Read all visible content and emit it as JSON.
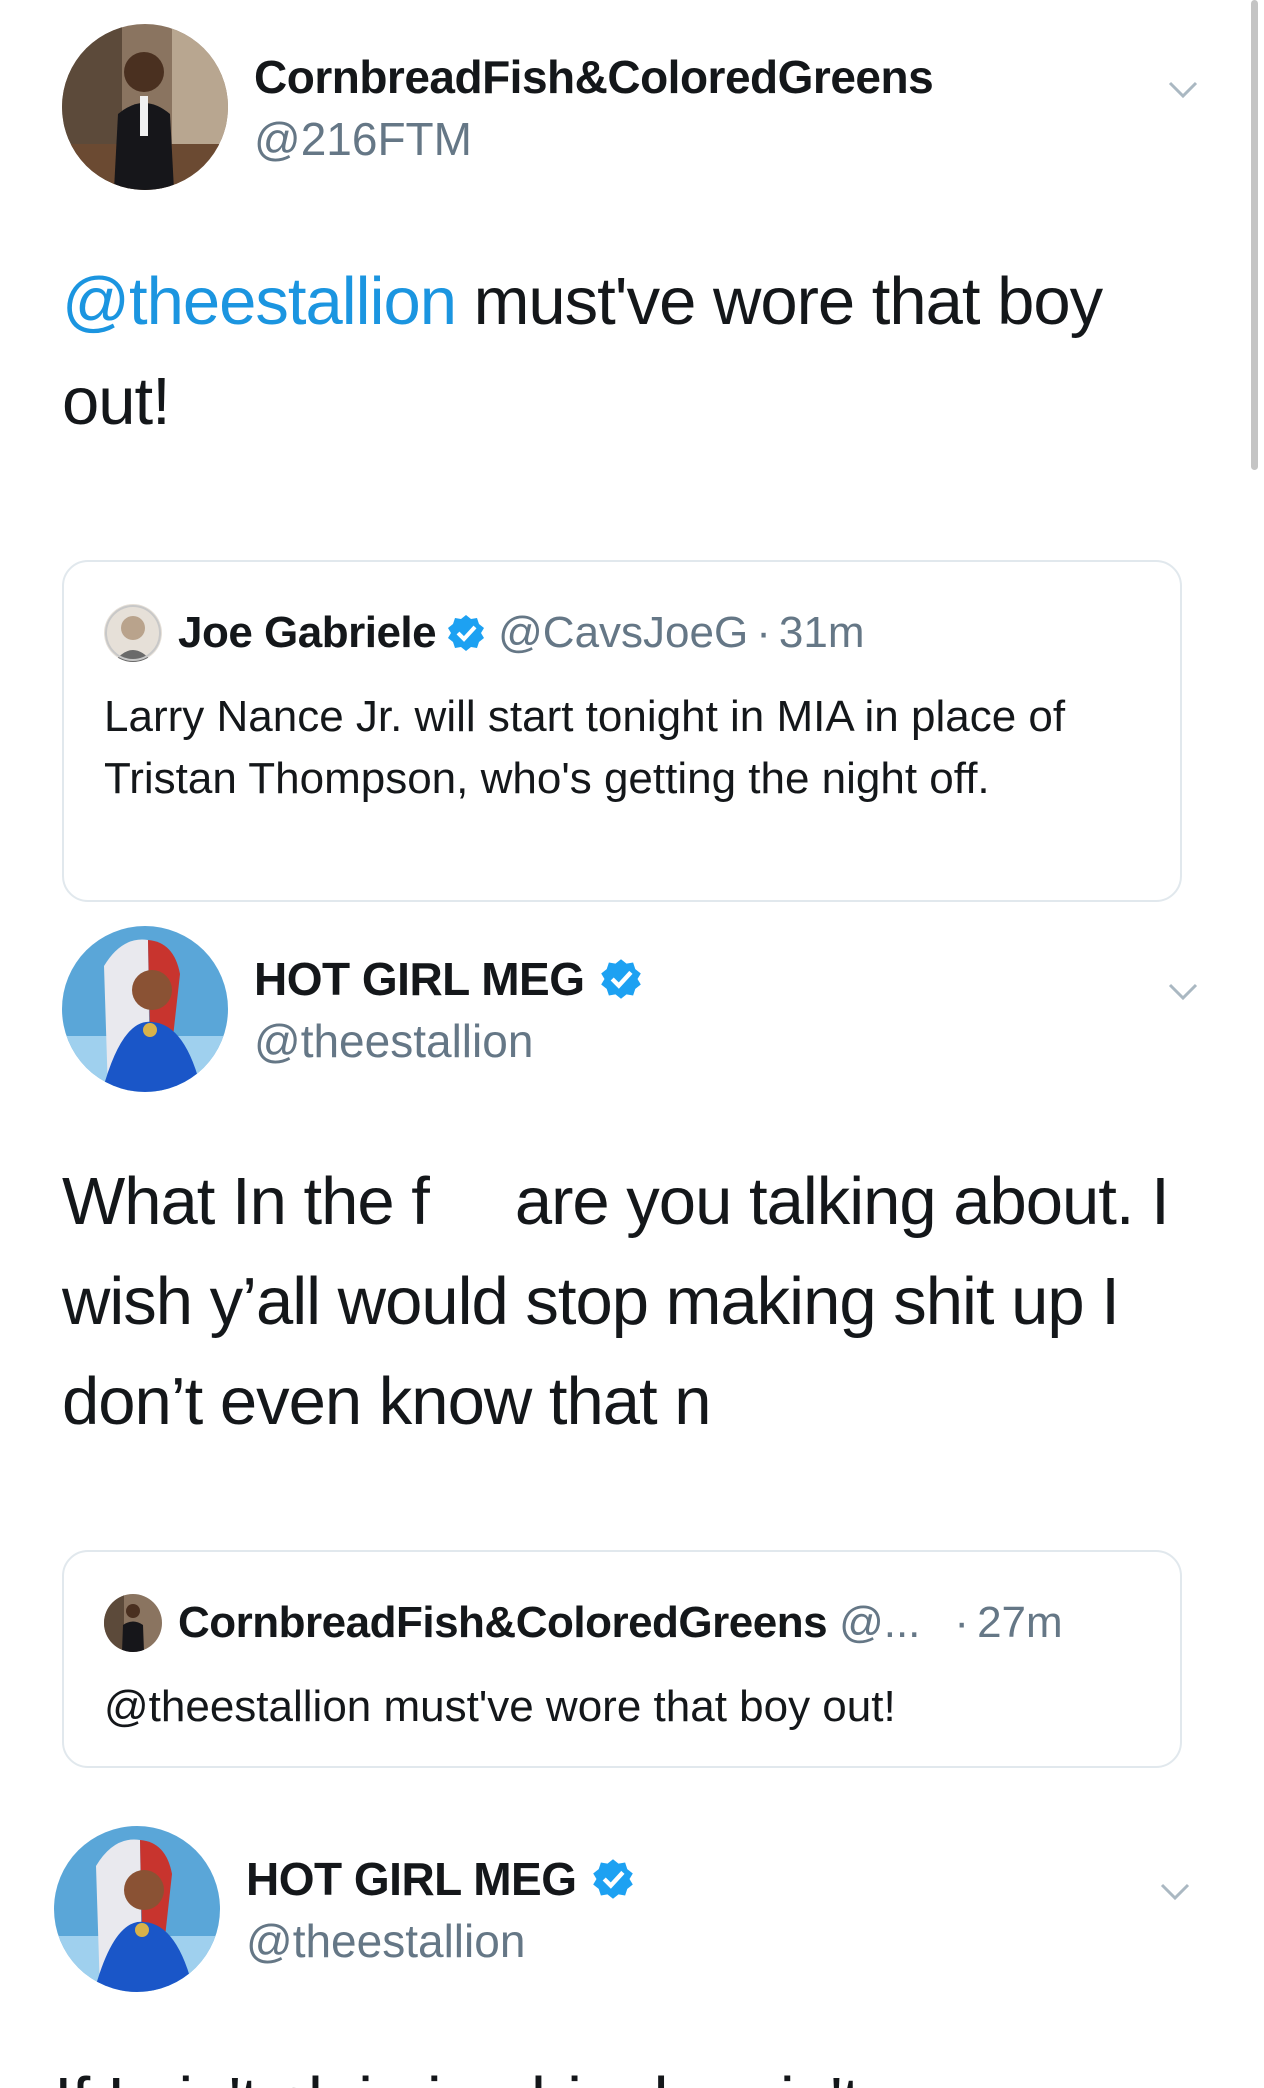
{
  "tweets": [
    {
      "name": "CornbreadFish&ColoredGreens",
      "handle": "@216FTM",
      "verified": false,
      "text_mention": "@theestallion",
      "text_rest": " must've wore that boy out!",
      "quote": {
        "name": "Joe Gabriele",
        "verified": true,
        "handle": "@CavsJoeG",
        "separator": "·",
        "time": "31m",
        "text": "Larry Nance Jr. will start tonight in MIA in place of Tristan Thompson, who's getting the night off."
      }
    },
    {
      "name": "HOT GIRL MEG",
      "handle": "@theestallion",
      "verified": true,
      "text_part1": "What In the f",
      "text_part2": "are you talking about. I wish y’all would stop making shit up I don’t even know that n",
      "quote": {
        "name": "CornbreadFish&ColoredGreens",
        "handle": "@...",
        "separator": "·",
        "time": "27m",
        "text": "@theestallion must've wore that boy out!"
      }
    },
    {
      "name": "HOT GIRL MEG",
      "handle": "@theestallion",
      "verified": true,
      "text_partial": "If I ain't claiming him he ain't"
    }
  ],
  "colors": {
    "mention": "#1b95e0",
    "verified": "#1da1f2",
    "secondary_text": "#657786",
    "border": "#e1e8ed"
  },
  "icons": [
    "chevron-down-icon",
    "verified-badge-icon"
  ]
}
